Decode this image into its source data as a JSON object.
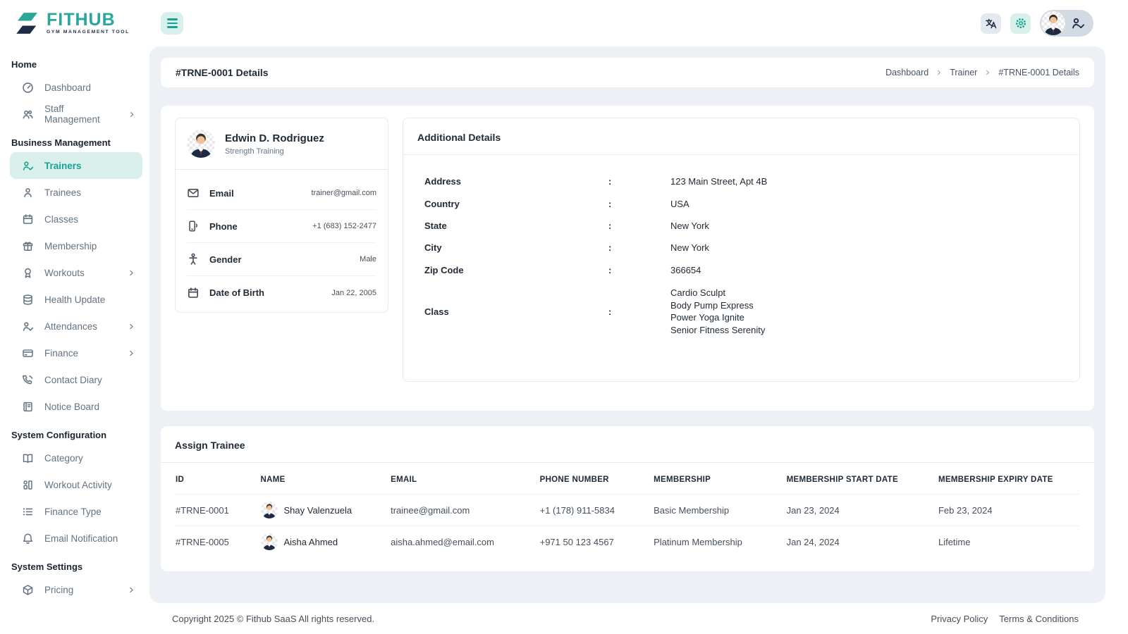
{
  "colors": {
    "accent": "#16A394",
    "accent_light": "#D9EFEC",
    "navy": "#1D2B45",
    "panel_bg": "#EDF1F6",
    "tie_red": "#B4342E"
  },
  "brand": {
    "name": "FITHUB",
    "tagline": "GYM MANAGEMENT TOOL"
  },
  "sidebar": {
    "sections": [
      {
        "label": "Home",
        "items": [
          {
            "label": "Dashboard",
            "icon": "dashboard-icon"
          },
          {
            "label": "Staff Management",
            "icon": "staff-icon",
            "chevron": true
          }
        ]
      },
      {
        "label": "Business Management",
        "items": [
          {
            "label": "Trainers",
            "icon": "trainer-check-icon",
            "active": true
          },
          {
            "label": "Trainees",
            "icon": "person-icon"
          },
          {
            "label": "Classes",
            "icon": "calendar-icon"
          },
          {
            "label": "Membership",
            "icon": "gift-icon"
          },
          {
            "label": "Workouts",
            "icon": "award-icon",
            "chevron": true
          },
          {
            "label": "Health Update",
            "icon": "database-icon"
          },
          {
            "label": "Attendances",
            "icon": "person-check-icon",
            "chevron": true
          },
          {
            "label": "Finance",
            "icon": "credit-card-icon",
            "chevron": true
          },
          {
            "label": "Contact Diary",
            "icon": "phone-call-icon"
          },
          {
            "label": "Notice Board",
            "icon": "notice-board-icon"
          }
        ]
      },
      {
        "label": "System Configuration",
        "items": [
          {
            "label": "Category",
            "icon": "book-icon"
          },
          {
            "label": "Workout Activity",
            "icon": "activity-grid-icon"
          },
          {
            "label": "Finance Type",
            "icon": "list-icon"
          },
          {
            "label": "Email Notification",
            "icon": "bell-icon"
          }
        ]
      },
      {
        "label": "System Settings",
        "items": [
          {
            "label": "Pricing",
            "icon": "package-icon",
            "chevron": true
          }
        ]
      }
    ]
  },
  "page": {
    "title": "#TRNE-0001 Details",
    "breadcrumb": [
      {
        "label": "Dashboard"
      },
      {
        "label": "Trainer"
      },
      {
        "label": "#TRNE-0001 Details"
      }
    ]
  },
  "profile": {
    "name": "Edwin D. Rodriguez",
    "specialty": "Strength Training",
    "fields": [
      {
        "icon": "email-icon",
        "label": "Email",
        "value": "trainer@gmail.com"
      },
      {
        "icon": "mobile-icon",
        "label": "Phone",
        "value": "+1 (683) 152-2477"
      },
      {
        "icon": "gender-icon",
        "label": "Gender",
        "value": "Male"
      },
      {
        "icon": "calendar-icon",
        "label": "Date of Birth",
        "value": "Jan 22, 2005"
      }
    ]
  },
  "additional_details": {
    "title": "Additional Details",
    "colon": ":",
    "rows": [
      {
        "label": "Address",
        "value": "123 Main Street, Apt 4B"
      },
      {
        "label": "Country",
        "value": "USA"
      },
      {
        "label": "State",
        "value": "New York"
      },
      {
        "label": "City",
        "value": "New York"
      },
      {
        "label": "Zip Code",
        "value": "366654"
      },
      {
        "label": "Class",
        "lines": [
          "Cardio Sculpt",
          "Body Pump Express",
          "Power Yoga Ignite",
          "Senior Fitness Serenity"
        ]
      }
    ]
  },
  "assign_trainee": {
    "title": "Assign Trainee",
    "columns": [
      "ID",
      "NAME",
      "EMAIL",
      "PHONE NUMBER",
      "MEMBERSHIP",
      "MEMBERSHIP START DATE",
      "MEMBERSHIP EXPIRY DATE"
    ],
    "rows": [
      {
        "id": "#TRNE-0001",
        "name": "Shay Valenzuela",
        "email": "trainee@gmail.com",
        "phone": "+1 (178) 911-5834",
        "membership": "Basic Membership",
        "start_date": "Jan 23, 2024",
        "expiry_date": "Feb 23, 2024"
      },
      {
        "id": "#TRNE-0005",
        "name": "Aisha Ahmed",
        "email": "aisha.ahmed@email.com",
        "phone": "+971 50 123 4567",
        "membership": "Platinum Membership",
        "start_date": "Jan 24, 2024",
        "expiry_date": "Lifetime"
      }
    ]
  },
  "footer": {
    "copyright": "Copyright 2025 © Fithub SaaS All rights reserved.",
    "links": [
      {
        "label": "Privacy Policy"
      },
      {
        "label": "Terms & Conditions"
      }
    ]
  }
}
